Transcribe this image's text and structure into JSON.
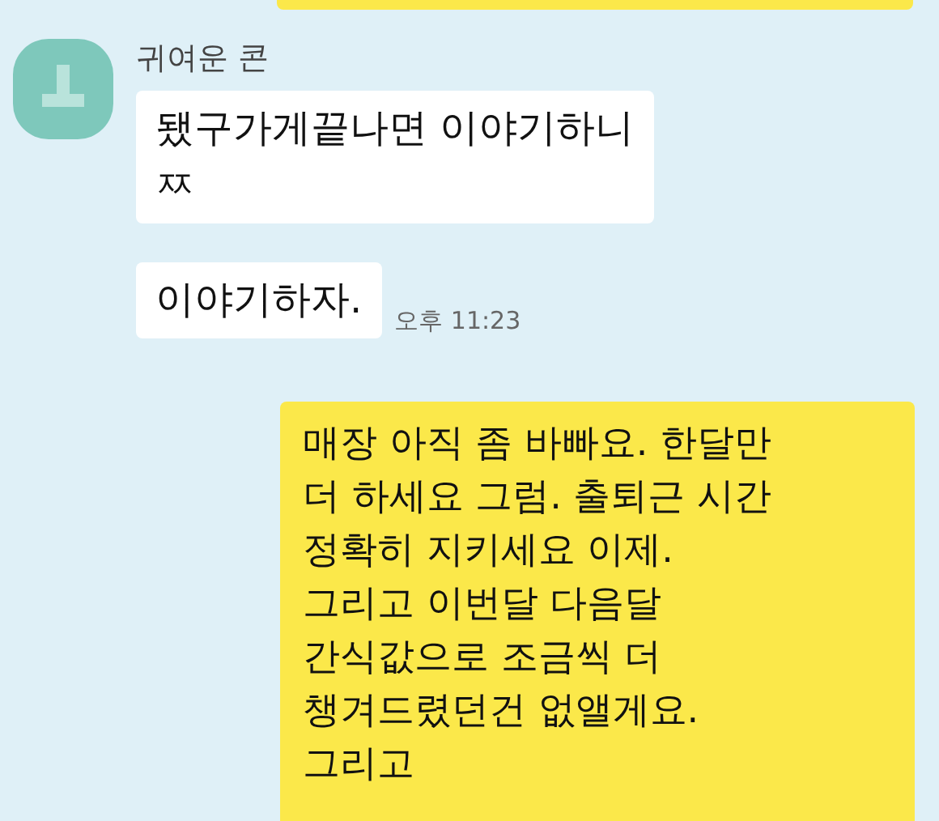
{
  "messages": [
    {
      "kind": "outgoing"
    },
    {
      "kind": "incoming",
      "sender": "귀여운 콘",
      "text": "됐구가게끝나면 이야기하니\nㅉ"
    },
    {
      "kind": "incoming",
      "text": "이야기하자.",
      "time": "오후 11:23"
    },
    {
      "kind": "outgoing",
      "text": "매장 아직 좀 바빠요. 한달만\n더 하세요 그럼. 출퇴근 시간\n정확히 지키세요 이제.\n그리고 이번달 다음달\n간식값으로 조금씩 더\n챙겨드렸던건 없앨게요.\n그리고"
    }
  ]
}
